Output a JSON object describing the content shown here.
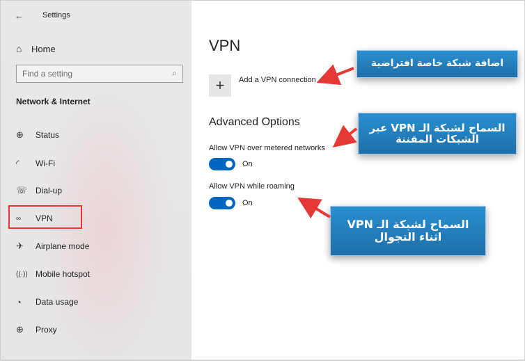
{
  "window": {
    "title": "Settings",
    "back_icon": "back-arrow-icon"
  },
  "sidebar": {
    "home_label": "Home",
    "search_placeholder": "Find a setting",
    "section_title": "Network & Internet",
    "items": [
      {
        "label": "Status",
        "icon": "globe-icon"
      },
      {
        "label": "Wi-Fi",
        "icon": "wifi-icon"
      },
      {
        "label": "Dial-up",
        "icon": "dialup-icon"
      },
      {
        "label": "VPN",
        "icon": "vpn-icon"
      },
      {
        "label": "Airplane mode",
        "icon": "airplane-icon"
      },
      {
        "label": "Mobile hotspot",
        "icon": "hotspot-icon"
      },
      {
        "label": "Data usage",
        "icon": "data-usage-icon"
      },
      {
        "label": "Proxy",
        "icon": "proxy-icon"
      }
    ],
    "highlight_color": "#e53935"
  },
  "main": {
    "title": "VPN",
    "add_label": "Add a VPN connection",
    "advanced_title": "Advanced Options",
    "options": [
      {
        "label": "Allow VPN over metered networks",
        "state": "On"
      },
      {
        "label": "Allow VPN while roaming",
        "state": "On"
      }
    ],
    "toggle_color": "#0067c0"
  },
  "callouts": {
    "add": "اضافة شبكة خاصة افتراضية",
    "metered_line1": "السماح لشبكة الـ VPN عبر",
    "metered_line2": "الشبكات المقننة",
    "roaming_line1": "السماح لشبكة الـ VPN",
    "roaming_line2": "اثناء التجوال",
    "color": "#1e6fa8",
    "arrow_color": "#e53935"
  }
}
